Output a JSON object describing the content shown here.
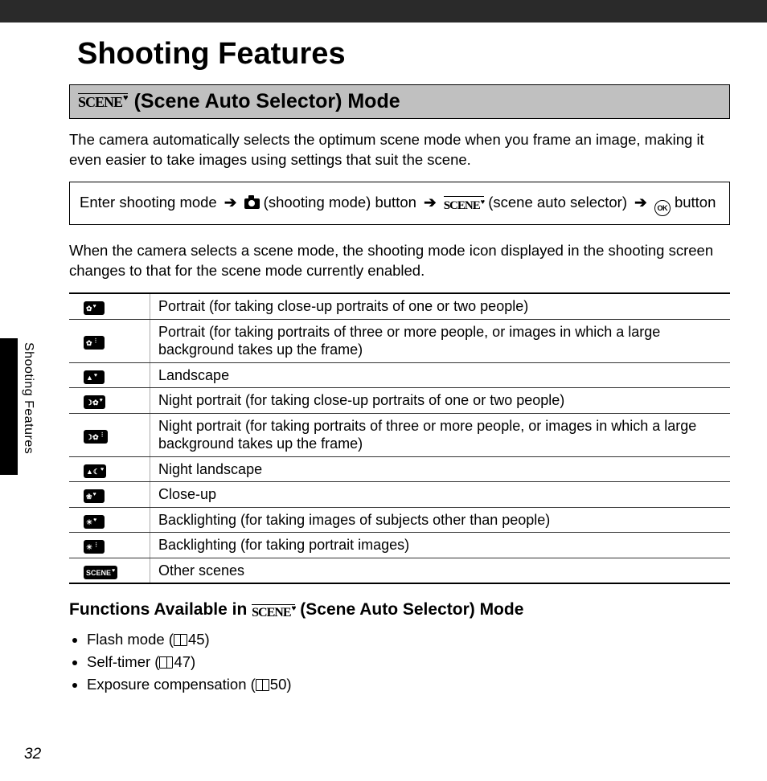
{
  "chapter_title": "Shooting Features",
  "side_label": "Shooting Features",
  "page_number": "32",
  "section": {
    "heading_text": "(Scene Auto Selector) Mode",
    "intro": "The camera automatically selects the optimum scene mode when you frame an image, making it even easier to take images using settings that suit the scene."
  },
  "nav_path": {
    "step1": "Enter shooting mode",
    "step2_after_icon": "(shooting mode) button",
    "step3_after_icon": "(scene auto selector)",
    "step4_after_icon": "button"
  },
  "after_nav": "When the camera selects a scene mode, the shooting mode icon displayed in the shooting screen changes to that for the scene mode currently enabled.",
  "scene_table": [
    {
      "icon": "portrait-1-icon",
      "glyph": "✿",
      "sup": "♥",
      "desc": "Portrait (for taking close-up portraits of one or two people)"
    },
    {
      "icon": "portrait-2-icon",
      "glyph": "✿",
      "sup": "⋮",
      "desc": "Portrait (for taking portraits of three or more people, or images in which a large background takes up the frame)"
    },
    {
      "icon": "landscape-icon",
      "glyph": "▲",
      "sup": "♥",
      "desc": "Landscape"
    },
    {
      "icon": "night-portrait-1-icon",
      "glyph": "☽✿",
      "sup": "♥",
      "desc": "Night portrait (for taking close-up portraits of one or two people)"
    },
    {
      "icon": "night-portrait-2-icon",
      "glyph": "☽✿",
      "sup": "⋮",
      "desc": "Night portrait (for taking portraits of three or more people, or images in which a large background takes up the frame)"
    },
    {
      "icon": "night-landscape-icon",
      "glyph": "▲☾",
      "sup": "♥",
      "desc": "Night landscape"
    },
    {
      "icon": "close-up-icon",
      "glyph": "❀",
      "sup": "♥",
      "desc": "Close-up"
    },
    {
      "icon": "backlighting-1-icon",
      "glyph": "☀",
      "sup": "♥",
      "desc": "Backlighting (for taking images of subjects other than people)"
    },
    {
      "icon": "backlighting-2-icon",
      "glyph": "☀",
      "sup": "⋮",
      "desc": "Backlighting (for taking portrait images)"
    },
    {
      "icon": "other-scenes-icon",
      "glyph": "SCENE",
      "sup": "♥",
      "desc": "Other scenes"
    }
  ],
  "functions": {
    "heading_prefix": "Functions Available in",
    "heading_suffix": "(Scene Auto Selector) Mode",
    "items": [
      {
        "label": "Flash mode",
        "page": "45"
      },
      {
        "label": "Self-timer",
        "page": "47"
      },
      {
        "label": "Exposure compensation",
        "page": "50"
      }
    ]
  }
}
